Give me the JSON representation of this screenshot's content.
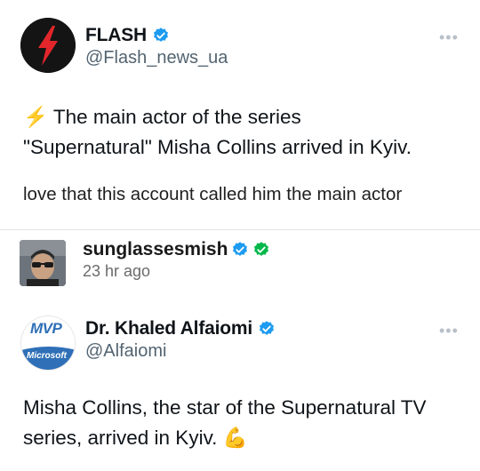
{
  "tweet1": {
    "display_name": "FLASH",
    "handle": "@Flash_news_ua",
    "more": "•••",
    "text_line1": "⚡ The main actor of the series",
    "text_line2": "\"Supernatural\" Misha Collins arrived in Kyiv.",
    "verified": true
  },
  "caption": "love that this account called him the main actor",
  "reblog": {
    "username": "sunglassesmish",
    "time": "23 hr ago"
  },
  "tweet2": {
    "display_name": "Dr. Khaled Alfaiomi",
    "handle": "@Alfaiomi",
    "more": "•••",
    "avatar_text_top": "MVP",
    "avatar_text_bottom": "Microsoft",
    "text_line1": "Misha Collins, the star of the Supernatural TV",
    "text_line2": "series, arrived in Kyiv. 💪",
    "verified": true
  },
  "colors": {
    "twitter_blue": "#1d9bf0",
    "tumblr_green": "#00b84a",
    "flash_red": "#e3262b"
  }
}
